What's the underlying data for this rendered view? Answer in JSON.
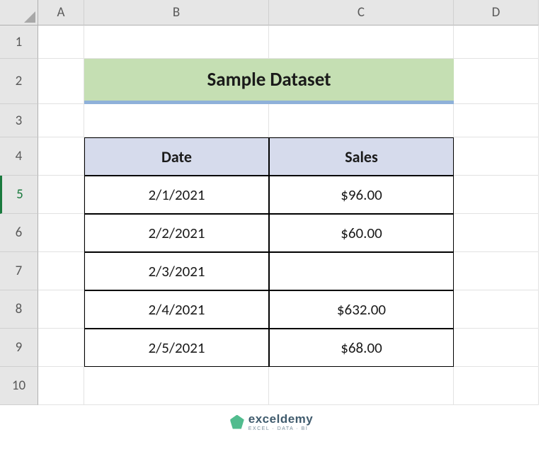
{
  "columns": [
    "A",
    "B",
    "C",
    "D"
  ],
  "rows": [
    "1",
    "2",
    "3",
    "4",
    "5",
    "6",
    "7",
    "8",
    "9",
    "10"
  ],
  "active_row": "5",
  "title": "Sample Dataset",
  "table": {
    "headers": {
      "date": "Date",
      "sales": "Sales"
    },
    "data": [
      {
        "date": "2/1/2021",
        "sales": "$96.00"
      },
      {
        "date": "2/2/2021",
        "sales": "$60.00"
      },
      {
        "date": "2/3/2021",
        "sales": ""
      },
      {
        "date": "2/4/2021",
        "sales": "$632.00"
      },
      {
        "date": "2/5/2021",
        "sales": "$68.00"
      }
    ]
  },
  "watermark": {
    "brand": "exceldemy",
    "tagline": "EXCEL · DATA · BI"
  },
  "chart_data": {
    "type": "table",
    "title": "Sample Dataset",
    "columns": [
      "Date",
      "Sales"
    ],
    "rows": [
      [
        "2/1/2021",
        96.0
      ],
      [
        "2/2/2021",
        60.0
      ],
      [
        "2/3/2021",
        null
      ],
      [
        "2/4/2021",
        632.0
      ],
      [
        "2/5/2021",
        68.0
      ]
    ],
    "currency": "USD"
  }
}
